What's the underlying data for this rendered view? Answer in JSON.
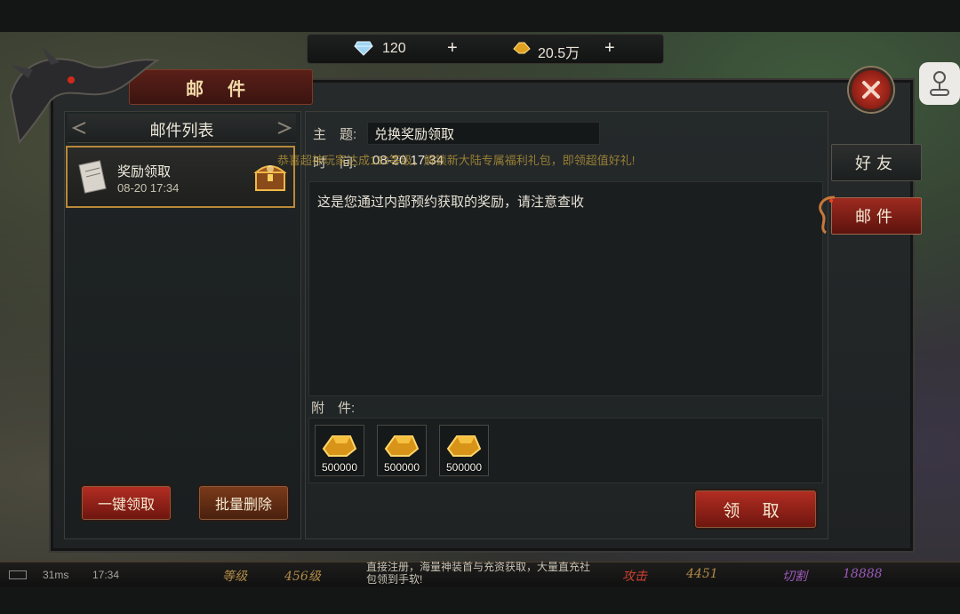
{
  "currency": {
    "diamond_icon": "diamond-icon",
    "diamond_value": "120",
    "gold_icon": "gold-ingot-icon",
    "gold_value": "20.5万",
    "plus_label": "+"
  },
  "panel": {
    "title": "邮 件",
    "close_icon": "close-icon"
  },
  "mail_list": {
    "title": "邮件列表",
    "items": [
      {
        "subject": "奖励领取",
        "time": "08-20 17:34",
        "icon": "letter-icon",
        "badge_icon": "treasure-chest-icon"
      }
    ],
    "claim_all_label": "一键领取",
    "batch_delete_label": "批量删除"
  },
  "detail": {
    "subject_label": "主　题:",
    "subject_value": "兑换奖励领取",
    "time_label": "时　间:",
    "time_value": "08-20 17:34",
    "banner": "恭喜超神玩家达成133等级，解锁新大陆专属福利礼包，即领超值好礼!",
    "body": "这是您通过内部预约获取的奖励，请注意查收",
    "attach_label": "附　件:",
    "attachments": [
      {
        "icon": "gold-ingot-icon",
        "count": "500000"
      },
      {
        "icon": "gold-ingot-icon",
        "count": "500000"
      },
      {
        "icon": "gold-ingot-icon",
        "count": "500000"
      }
    ],
    "claim_label": "领 取"
  },
  "tabs": {
    "friends": "好友",
    "mail": "邮件"
  },
  "hud": {
    "ping": "31ms",
    "clock": "17:34",
    "level_label": "等级",
    "level_value": "456级",
    "chat_line1": "直接注册，海量神装首与充资获取，大量直充社",
    "chat_line2": "包领到手软!",
    "attack_label": "攻击",
    "attack_value": "4451",
    "cut_label": "切割",
    "cut_value": "18888"
  },
  "colors": {
    "accent_red": "#b22d22",
    "border_gold": "#b8893a",
    "panel_bg": "#1f2324"
  }
}
